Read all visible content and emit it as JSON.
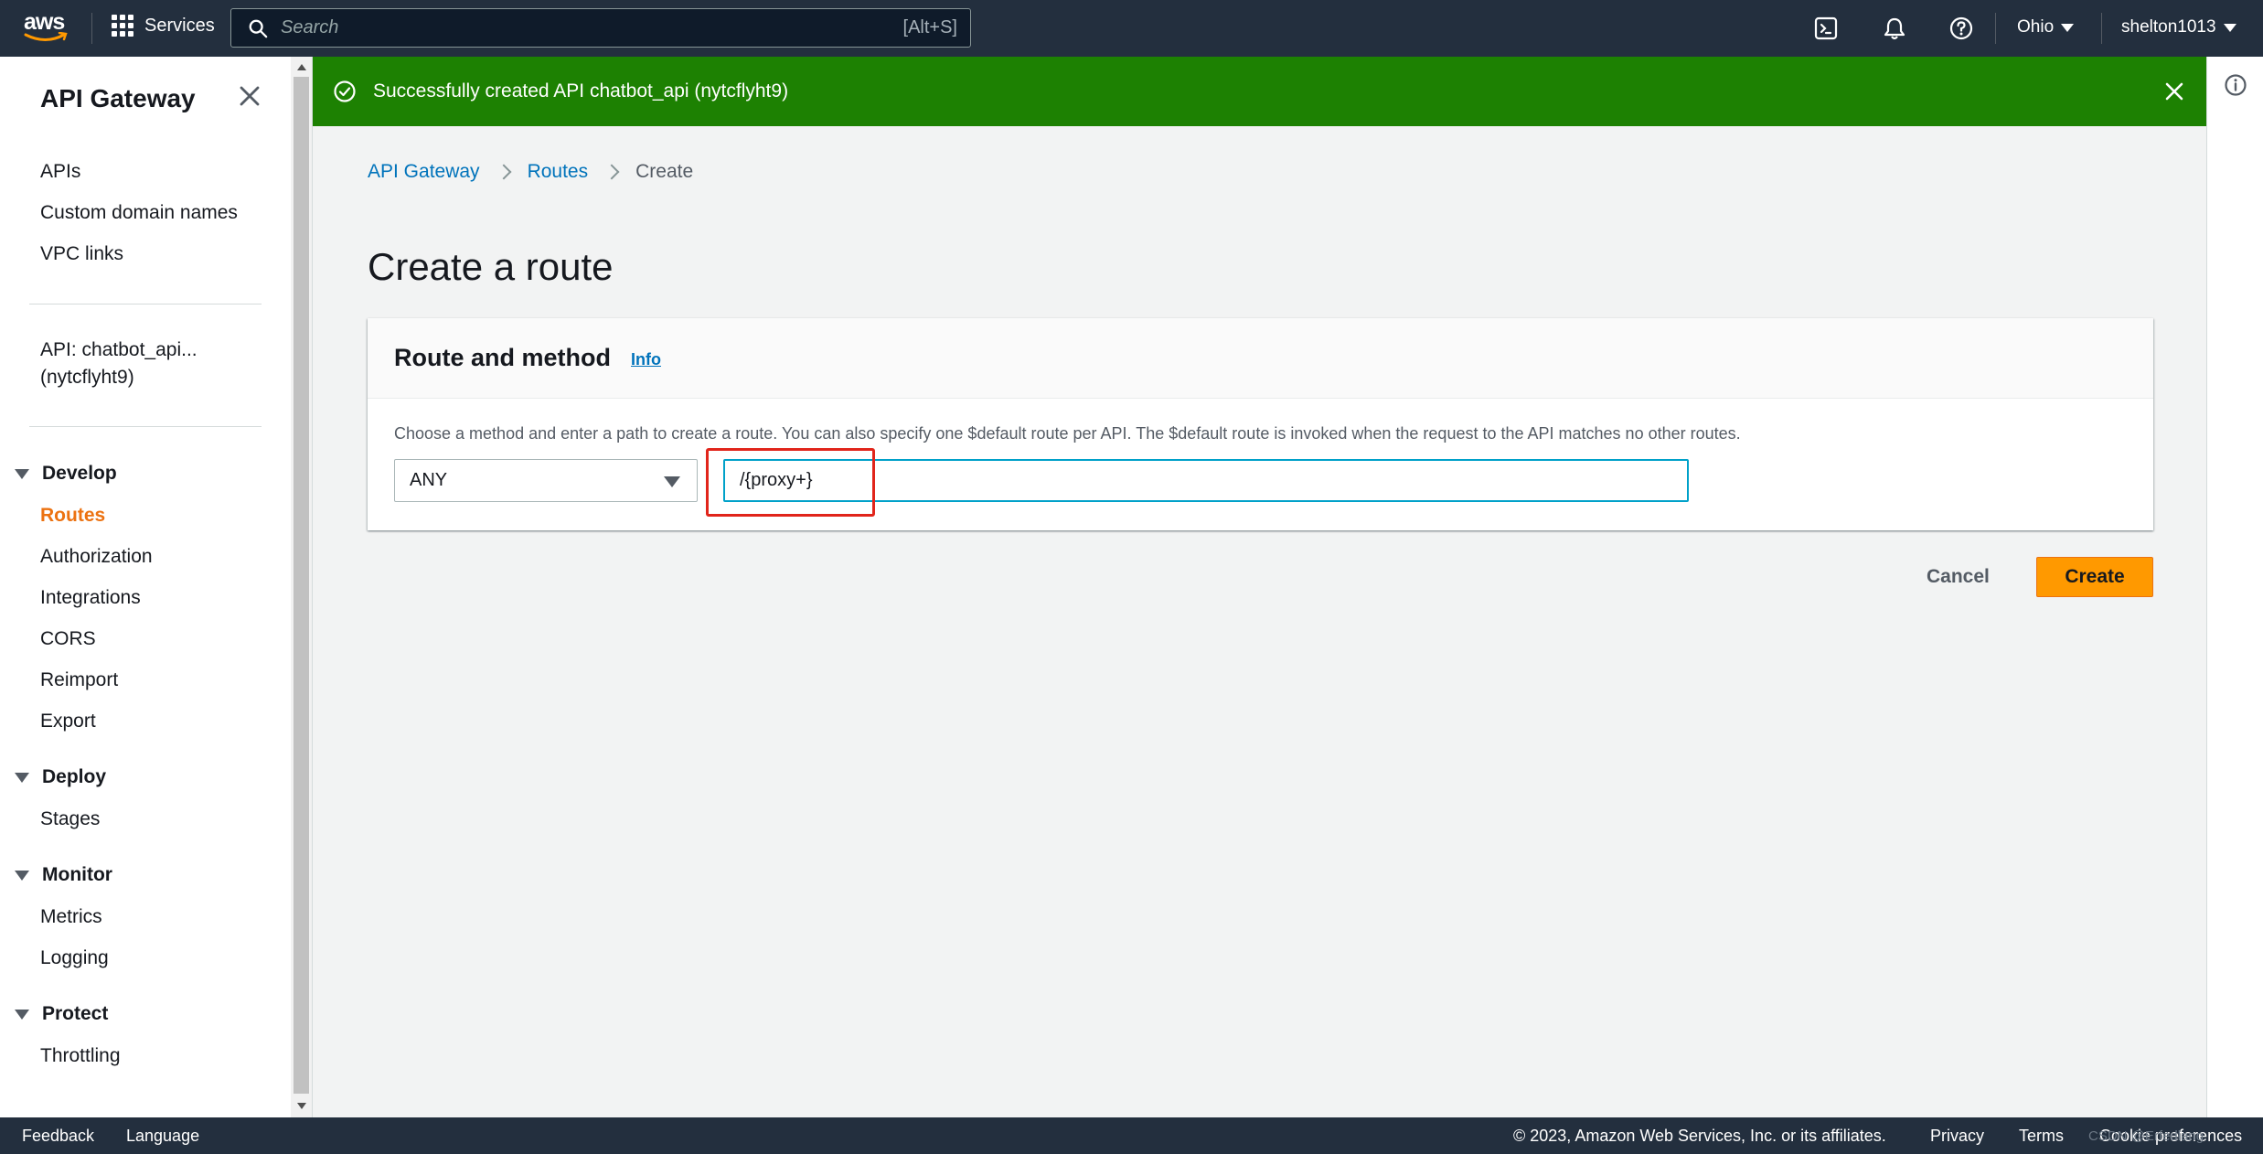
{
  "topnav": {
    "logo_text": "aws",
    "services_label": "Services",
    "search_placeholder": "Search",
    "search_shortcut": "[Alt+S]",
    "region": "Ohio",
    "account": "shelton1013"
  },
  "sidebar": {
    "title": "API Gateway",
    "top_links": [
      "APIs",
      "Custom domain names",
      "VPC links"
    ],
    "api_line1": "API: chatbot_api...",
    "api_line2": "(nytcflyht9)",
    "sections": [
      {
        "label": "Develop",
        "items": [
          "Routes",
          "Authorization",
          "Integrations",
          "CORS",
          "Reimport",
          "Export"
        ]
      },
      {
        "label": "Deploy",
        "items": [
          "Stages"
        ]
      },
      {
        "label": "Monitor",
        "items": [
          "Metrics",
          "Logging"
        ]
      },
      {
        "label": "Protect",
        "items": [
          "Throttling"
        ]
      }
    ],
    "active_item": "Routes"
  },
  "flash": {
    "message": "Successfully created API chatbot_api (nytcflyht9)"
  },
  "breadcrumb": [
    "API Gateway",
    "Routes",
    "Create"
  ],
  "page_title": "Create a route",
  "panel": {
    "title": "Route and method",
    "info_label": "Info",
    "description": "Choose a method and enter a path to create a route. You can also specify one $default route per API. The $default route is invoked when the request to the API matches no other routes.",
    "method_value": "ANY",
    "path_value": "/{proxy+}"
  },
  "actions": {
    "cancel_label": "Cancel",
    "create_label": "Create"
  },
  "footer": {
    "feedback": "Feedback",
    "language": "Language",
    "copyright": "© 2023, Amazon Web Services, Inc. or its affiliates.",
    "privacy": "Privacy",
    "terms": "Terms",
    "cookie": "Cookie preferences",
    "watermark": "CSDN @Erfedlang"
  },
  "colors": {
    "nav_bg": "#232f3e",
    "flash_bg": "#1d8102",
    "accent_orange": "#ec7211",
    "link_blue": "#0073bb",
    "highlight_red": "#e1251b"
  }
}
